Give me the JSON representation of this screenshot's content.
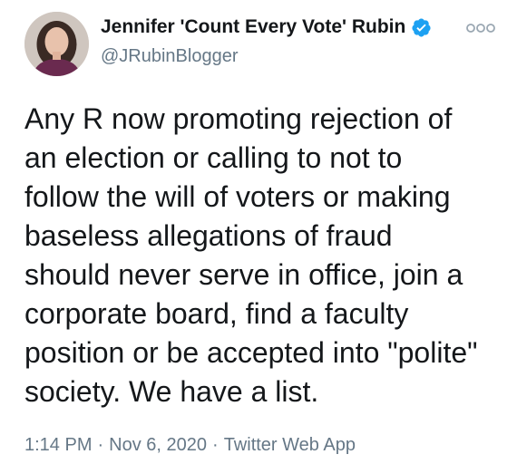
{
  "author": {
    "display_name": "Jennifer 'Count Every Vote' Rubin",
    "handle": "@JRubinBlogger",
    "verified": true
  },
  "tweet": {
    "text": "Any R now promoting rejection of\nan election or calling to not to\nfollow the will of voters or making\nbaseless allegations of fraud\nshould never serve in office, join a\ncorporate board, find a faculty\nposition or be accepted into \"polite\"\nsociety. We have a list."
  },
  "meta": {
    "time": "1:14 PM",
    "separator": "·",
    "date": "Nov 6, 2020",
    "source": "Twitter Web App"
  },
  "icons": {
    "verified": "verified-badge-icon",
    "more": "more-options-icon"
  },
  "colors": {
    "text": "#14171a",
    "secondary": "#657786",
    "verified_blue": "#1da1f2",
    "background": "#ffffff"
  }
}
